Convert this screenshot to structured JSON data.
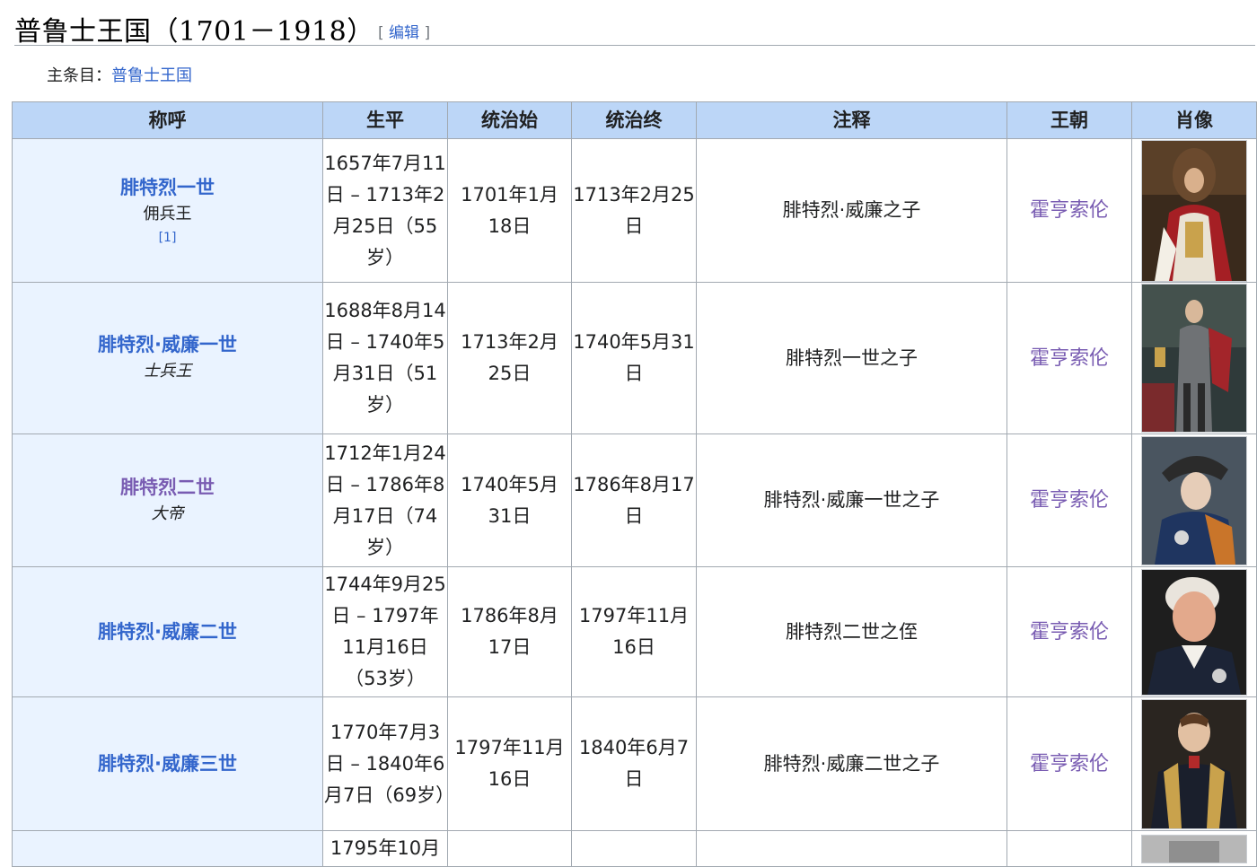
{
  "section": {
    "title": "普鲁士王国（1701－1918）",
    "edit_open": "[",
    "edit_label": "编辑",
    "edit_close": "]"
  },
  "hatnote": {
    "label": "主条目：",
    "link": "普鲁士王国"
  },
  "table": {
    "headers": [
      "称呼",
      "生平",
      "统治始",
      "统治终",
      "注释",
      "王朝",
      "肖像"
    ],
    "rows": [
      {
        "name": "腓特烈一世",
        "epithet": "佣兵王",
        "ref": "[1]",
        "life": "1657年7月11日 – 1713年2月25日（55岁）",
        "reign_start": "1701年1月18日",
        "reign_end": "1713年2月25日",
        "note": "腓特烈·威廉之子",
        "dynasty": "霍亨索伦",
        "portrait_icon": "portrait-frederick-i"
      },
      {
        "name": "腓特烈·威廉一世",
        "epithet": "士兵王",
        "ref": "",
        "life": "1688年8月14日 – 1740年5月31日（51岁）",
        "reign_start": "1713年2月25日",
        "reign_end": "1740年5月31日",
        "note": "腓特烈一世之子",
        "dynasty": "霍亨索伦",
        "portrait_icon": "portrait-frederick-william-i"
      },
      {
        "name": "腓特烈二世",
        "epithet": "大帝",
        "ref": "",
        "life": "1712年1月24日 – 1786年8月17日（74岁）",
        "reign_start": "1740年5月31日",
        "reign_end": "1786年8月17日",
        "note": "腓特烈·威廉一世之子",
        "dynasty": "霍亨索伦",
        "portrait_icon": "portrait-frederick-ii"
      },
      {
        "name": "腓特烈·威廉二世",
        "epithet": "",
        "ref": "",
        "life": "1744年9月25日 – 1797年11月16日（53岁）",
        "reign_start": "1786年8月17日",
        "reign_end": "1797年11月16日",
        "note": "腓特烈二世之侄",
        "dynasty": "霍亨索伦",
        "portrait_icon": "portrait-frederick-william-ii"
      },
      {
        "name": "腓特烈·威廉三世",
        "epithet": "",
        "ref": "",
        "life": "1770年7月3日 – 1840年6月7日（69岁）",
        "reign_start": "1797年11月16日",
        "reign_end": "1840年6月7日",
        "note": "腓特烈·威廉二世之子",
        "dynasty": "霍亨索伦",
        "portrait_icon": "portrait-frederick-william-iii"
      },
      {
        "life_partial": "1795年10月"
      }
    ]
  },
  "colors": {
    "link": "#3366cc",
    "visited_link": "#795cb2",
    "header_bg": "#bcd6f7",
    "name_cell_bg": "#eaf3ff",
    "border": "#a2a9b1"
  }
}
